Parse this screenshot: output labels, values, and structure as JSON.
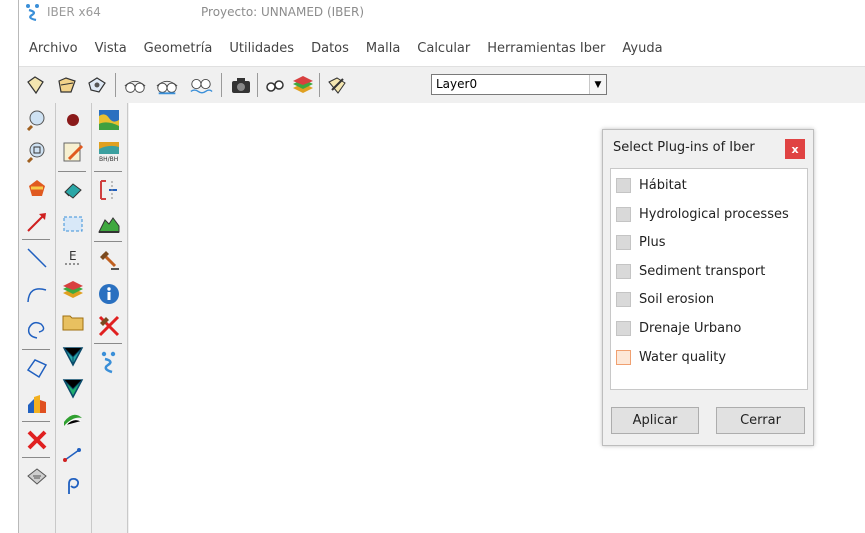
{
  "window": {
    "app_name": "IBER x64",
    "project_title": "Proyecto: UNNAMED (IBER)"
  },
  "menu": [
    "Archivo",
    "Vista",
    "Geometría",
    "Utilidades",
    "Datos",
    "Malla",
    "Calcular",
    "Herramientas Iber",
    "Ayuda"
  ],
  "toolbar": {
    "icons": [
      "new-file-icon",
      "open-folder-icon",
      "save-icon",
      "zoom-in-glasses-icon",
      "zoom-out-glasses-icon",
      "render-glasses-icon",
      "camera-icon",
      "binoculars-icon",
      "layers-icon",
      "edit-icon"
    ],
    "layer_value": "Layer0"
  },
  "left_toolbar": {
    "col1": [
      "zoom-icon",
      "zoom-frame-icon",
      "rotate-icon",
      "pointer-arrow-icon",
      "line-icon",
      "arc-icon",
      "curve-icon",
      "polygon-icon",
      "surface-icon",
      "delete-icon",
      "list-icon"
    ],
    "col2": [
      "point-icon",
      "edit-pencil-icon",
      "eraser-icon",
      "select-box-icon",
      "text-e-icon",
      "layers-stack-icon",
      "folder-icon",
      "mesh-tri-icon",
      "mesh-tri2-icon",
      "surface-green-icon",
      "node-link-icon",
      "loop-icon"
    ],
    "col3": [
      "map-terrain-icon",
      "map-gradient-icon",
      "bracket-icon",
      "hill-profile-icon",
      "hammer-icon",
      "info-icon",
      "hammer-cross-icon",
      "iber-logo-icon"
    ]
  },
  "dialog": {
    "title": "Select Plug-ins of Iber",
    "close": "x",
    "plugins": [
      {
        "label": "Hábitat",
        "checked": false
      },
      {
        "label": "Hydrological processes",
        "checked": false
      },
      {
        "label": "Plus",
        "checked": false
      },
      {
        "label": "Sediment transport",
        "checked": false
      },
      {
        "label": "Soil erosion",
        "checked": false
      },
      {
        "label": "Drenaje Urbano",
        "checked": false
      },
      {
        "label": "Water quality",
        "checked": false,
        "highlighted": true
      }
    ],
    "apply_label": "Aplicar",
    "close_label": "Cerrar"
  },
  "colors": {
    "close_button": "#e04343",
    "highlight_box": "#f0a070"
  }
}
